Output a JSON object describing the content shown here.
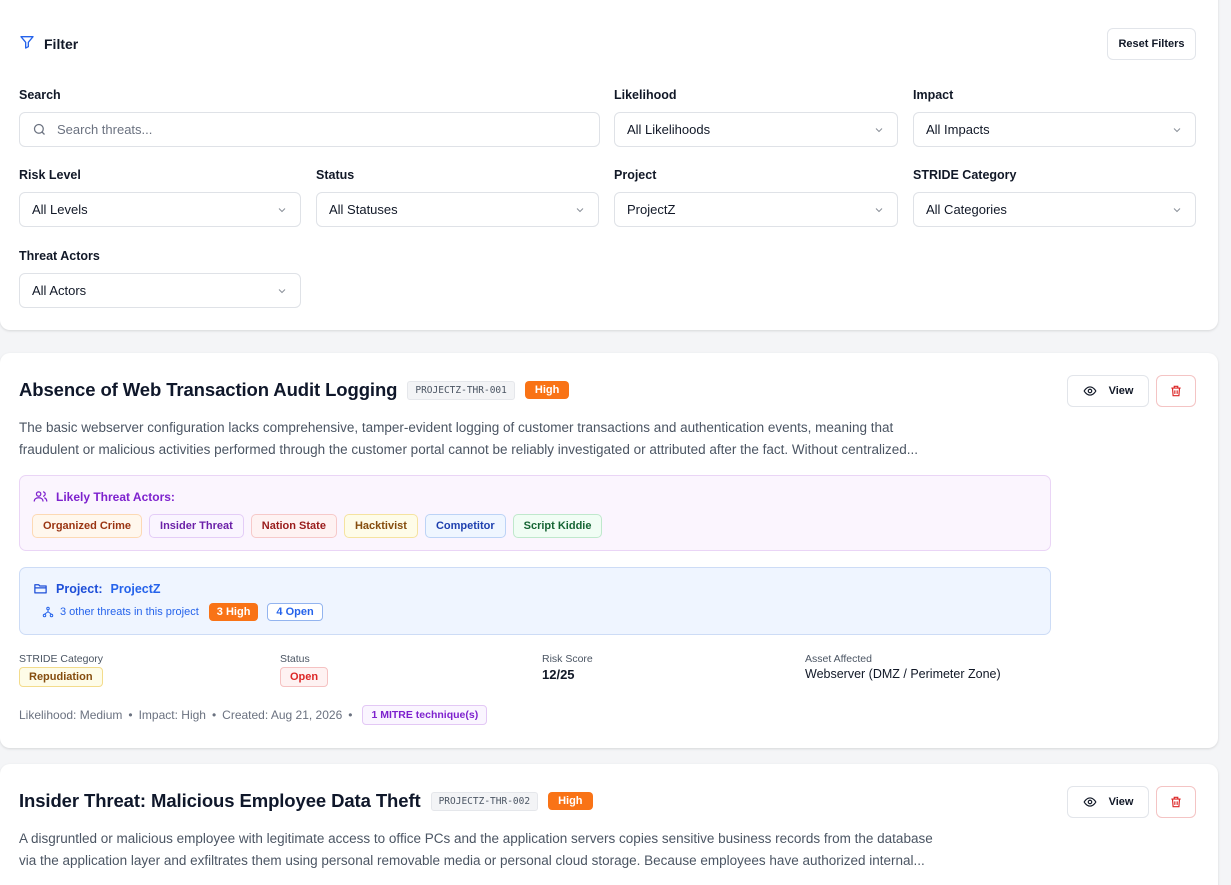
{
  "filter": {
    "title": "Filter",
    "reset_label": "Reset Filters",
    "search": {
      "label": "Search",
      "placeholder": "Search threats..."
    },
    "likelihood": {
      "label": "Likelihood",
      "value": "All Likelihoods"
    },
    "impact": {
      "label": "Impact",
      "value": "All Impacts"
    },
    "risk_level": {
      "label": "Risk Level",
      "value": "All Levels"
    },
    "status": {
      "label": "Status",
      "value": "All Statuses"
    },
    "project": {
      "label": "Project",
      "value": "ProjectZ"
    },
    "stride": {
      "label": "STRIDE Category",
      "value": "All Categories"
    },
    "actors": {
      "label": "Threat Actors",
      "value": "All Actors"
    }
  },
  "threats": [
    {
      "title": "Absence of Web Transaction Audit Logging",
      "id": "PROJECTZ-THR-001",
      "severity": "High",
      "view_label": "View",
      "description_line1": "The basic webserver configuration lacks comprehensive, tamper-evident logging of customer transactions and authentication events, meaning that",
      "description_line2": "fraudulent or malicious activities performed through the customer portal cannot be reliably investigated or attributed after the fact. Without centralized...",
      "actors_title": "Likely Threat Actors:",
      "actors": [
        "Organized Crime",
        "Insider Threat",
        "Nation State",
        "Hacktivist",
        "Competitor",
        "Script Kiddie"
      ],
      "project_prefix": "Project:",
      "project_name": "ProjectZ",
      "project_others": "3 other threats in this project",
      "project_high": "3 High",
      "project_open": "4 Open",
      "stride_label": "STRIDE Category",
      "stride_value": "Repudiation",
      "status_label": "Status",
      "status_value": "Open",
      "risk_label": "Risk Score",
      "risk_value": "12/25",
      "asset_label": "Asset Affected",
      "asset_value": "Webserver (DMZ / Perimeter Zone)",
      "likelihood_text": "Likelihood: Medium",
      "impact_text": "Impact: High",
      "created_text": "Created: Aug 21, 2026",
      "mitre_text": "1 MITRE technique(s)"
    },
    {
      "title": "Insider Threat: Malicious Employee Data Theft",
      "id": "PROJECTZ-THR-002",
      "severity": "High",
      "view_label": "View",
      "description_line1": "A disgruntled or malicious employee with legitimate access to office PCs and the application servers copies sensitive business records from the database",
      "description_line2": "via the application layer and exfiltrates them using personal removable media or personal cloud storage. Because employees have authorized internal..."
    }
  ],
  "colors": {
    "accent": "#2563eb",
    "severity_high": "#f97316",
    "delete": "#dc2626",
    "actor_purple": "#7e22ce"
  }
}
